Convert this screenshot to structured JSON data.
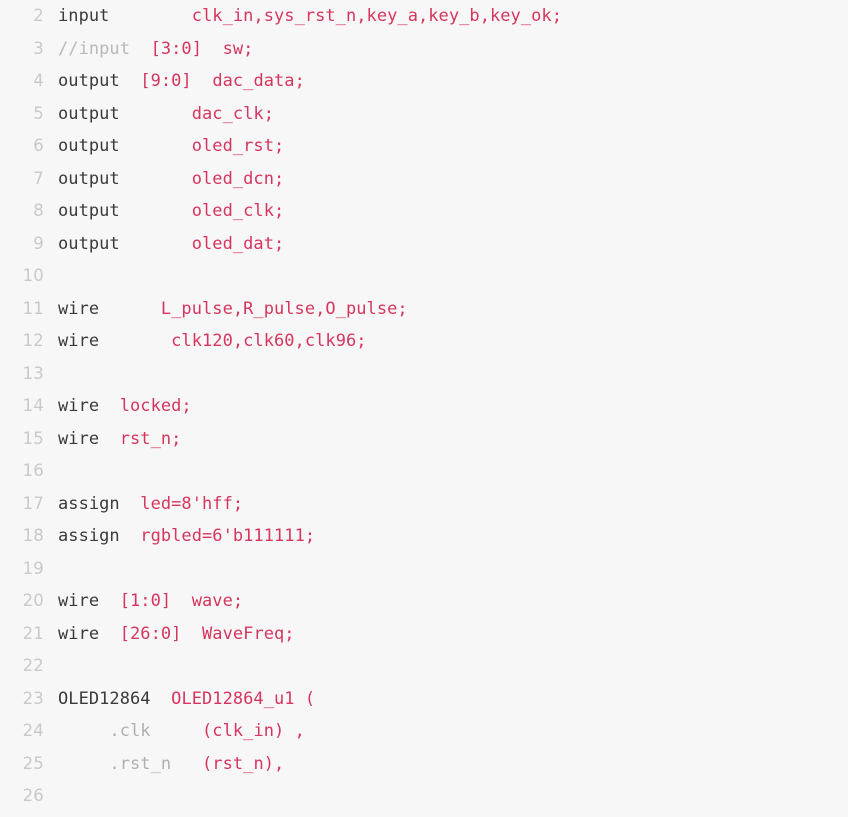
{
  "editor": {
    "language": "verilog",
    "background_color": "#f7f7f7",
    "gutter_color": "#c9c9c9",
    "first_line_number": 2,
    "last_line_number": 26,
    "colors": {
      "keyword": "#3a3a3a",
      "identifier": "#d6355e",
      "comment": "#b8b8b8",
      "port": "#b0b0b0",
      "plain": "#3a3a3a"
    }
  },
  "lines": [
    {
      "number": "2",
      "tokens": [
        {
          "text": "input",
          "kind": "keyword"
        },
        {
          "text": "        ",
          "kind": "plain"
        },
        {
          "text": "clk_in,sys_rst_n,key_a,key_b,key_ok;",
          "kind": "ident"
        }
      ]
    },
    {
      "number": "3",
      "tokens": [
        {
          "text": "//input",
          "kind": "comment"
        },
        {
          "text": "  ",
          "kind": "plain"
        },
        {
          "text": "[3:0]",
          "kind": "ident"
        },
        {
          "text": "  ",
          "kind": "plain"
        },
        {
          "text": "sw;",
          "kind": "ident"
        }
      ]
    },
    {
      "number": "4",
      "tokens": [
        {
          "text": "output",
          "kind": "keyword"
        },
        {
          "text": "  ",
          "kind": "plain"
        },
        {
          "text": "[9:0]",
          "kind": "ident"
        },
        {
          "text": "  ",
          "kind": "plain"
        },
        {
          "text": "dac_data;",
          "kind": "ident"
        }
      ]
    },
    {
      "number": "5",
      "tokens": [
        {
          "text": "output",
          "kind": "keyword"
        },
        {
          "text": "       ",
          "kind": "plain"
        },
        {
          "text": "dac_clk;",
          "kind": "ident"
        }
      ]
    },
    {
      "number": "6",
      "tokens": [
        {
          "text": "output",
          "kind": "keyword"
        },
        {
          "text": "       ",
          "kind": "plain"
        },
        {
          "text": "oled_rst;",
          "kind": "ident"
        }
      ]
    },
    {
      "number": "7",
      "tokens": [
        {
          "text": "output",
          "kind": "keyword"
        },
        {
          "text": "       ",
          "kind": "plain"
        },
        {
          "text": "oled_dcn;",
          "kind": "ident"
        }
      ]
    },
    {
      "number": "8",
      "tokens": [
        {
          "text": "output",
          "kind": "keyword"
        },
        {
          "text": "       ",
          "kind": "plain"
        },
        {
          "text": "oled_clk;",
          "kind": "ident"
        }
      ]
    },
    {
      "number": "9",
      "tokens": [
        {
          "text": "output",
          "kind": "keyword"
        },
        {
          "text": "       ",
          "kind": "plain"
        },
        {
          "text": "oled_dat;",
          "kind": "ident"
        }
      ]
    },
    {
      "number": "10",
      "tokens": []
    },
    {
      "number": "11",
      "tokens": [
        {
          "text": "wire",
          "kind": "keyword"
        },
        {
          "text": "      ",
          "kind": "plain"
        },
        {
          "text": "L_pulse,R_pulse,O_pulse;",
          "kind": "ident"
        }
      ]
    },
    {
      "number": "12",
      "tokens": [
        {
          "text": "wire",
          "kind": "keyword"
        },
        {
          "text": "       ",
          "kind": "plain"
        },
        {
          "text": "clk120,clk60,clk96;",
          "kind": "ident"
        }
      ]
    },
    {
      "number": "13",
      "tokens": []
    },
    {
      "number": "14",
      "tokens": [
        {
          "text": "wire",
          "kind": "keyword"
        },
        {
          "text": "  ",
          "kind": "plain"
        },
        {
          "text": "locked;",
          "kind": "ident"
        }
      ]
    },
    {
      "number": "15",
      "tokens": [
        {
          "text": "wire",
          "kind": "keyword"
        },
        {
          "text": "  ",
          "kind": "plain"
        },
        {
          "text": "rst_n;",
          "kind": "ident"
        }
      ]
    },
    {
      "number": "16",
      "tokens": []
    },
    {
      "number": "17",
      "tokens": [
        {
          "text": "assign",
          "kind": "keyword"
        },
        {
          "text": "  ",
          "kind": "plain"
        },
        {
          "text": "led=8'hff;",
          "kind": "ident"
        }
      ]
    },
    {
      "number": "18",
      "tokens": [
        {
          "text": "assign",
          "kind": "keyword"
        },
        {
          "text": "  ",
          "kind": "plain"
        },
        {
          "text": "rgbled=6'b111111;",
          "kind": "ident"
        }
      ]
    },
    {
      "number": "19",
      "tokens": []
    },
    {
      "number": "20",
      "tokens": [
        {
          "text": "wire",
          "kind": "keyword"
        },
        {
          "text": "  ",
          "kind": "plain"
        },
        {
          "text": "[1:0]",
          "kind": "ident"
        },
        {
          "text": "  ",
          "kind": "plain"
        },
        {
          "text": "wave;",
          "kind": "ident"
        }
      ]
    },
    {
      "number": "21",
      "tokens": [
        {
          "text": "wire",
          "kind": "keyword"
        },
        {
          "text": "  ",
          "kind": "plain"
        },
        {
          "text": "[26:0]",
          "kind": "ident"
        },
        {
          "text": "  ",
          "kind": "plain"
        },
        {
          "text": "WaveFreq;",
          "kind": "ident"
        }
      ]
    },
    {
      "number": "22",
      "tokens": []
    },
    {
      "number": "23",
      "tokens": [
        {
          "text": "OLED12864",
          "kind": "keyword"
        },
        {
          "text": "  ",
          "kind": "plain"
        },
        {
          "text": "OLED12864_u1 (",
          "kind": "ident"
        }
      ]
    },
    {
      "number": "24",
      "tokens": [
        {
          "text": "     ",
          "kind": "plain"
        },
        {
          "text": ".clk",
          "kind": "port"
        },
        {
          "text": "     ",
          "kind": "plain"
        },
        {
          "text": "(clk_in) ,",
          "kind": "ident"
        }
      ]
    },
    {
      "number": "25",
      "tokens": [
        {
          "text": "     ",
          "kind": "plain"
        },
        {
          "text": ".rst_n",
          "kind": "port"
        },
        {
          "text": "   ",
          "kind": "plain"
        },
        {
          "text": "(rst_n),",
          "kind": "ident"
        }
      ]
    },
    {
      "number": "26",
      "tokens": []
    }
  ]
}
